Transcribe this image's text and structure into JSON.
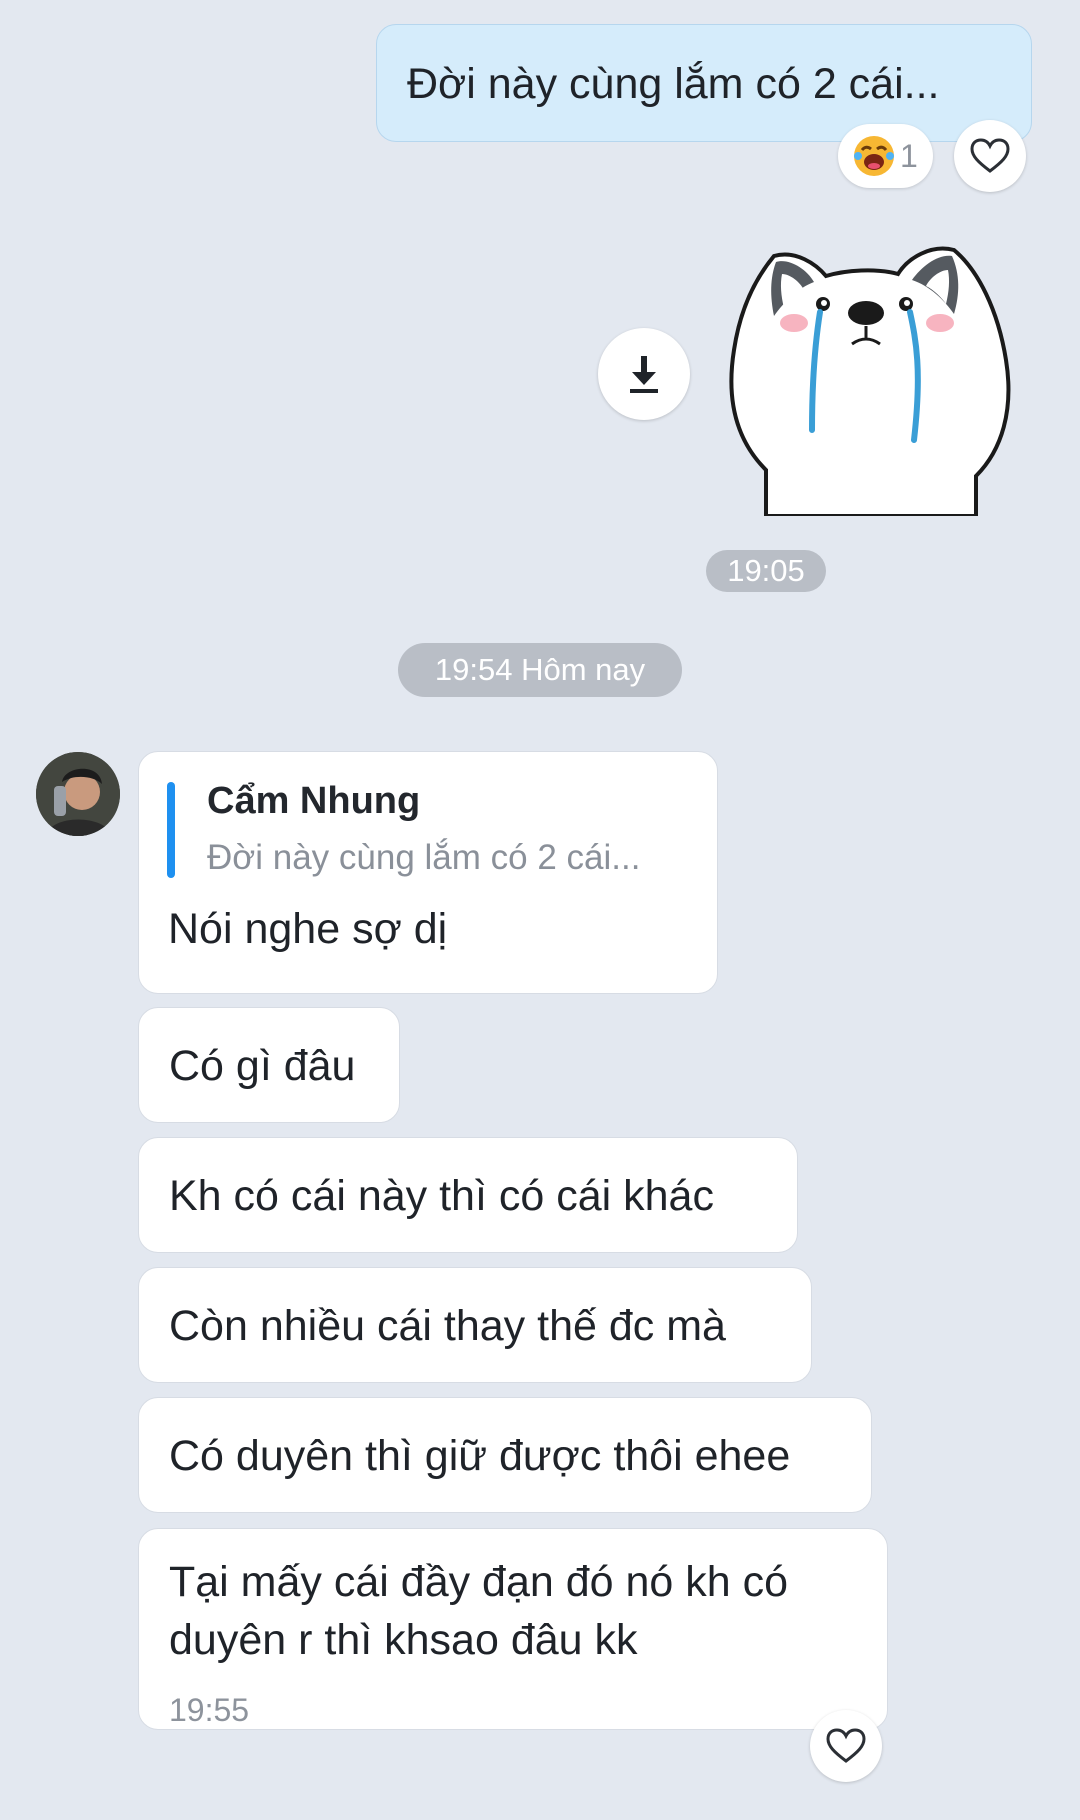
{
  "outgoing": {
    "message": "Đời này cùng lắm có 2 cái...",
    "reaction_count": "1",
    "sticker_time": "19:05"
  },
  "date_separator": "19:54 Hôm nay",
  "incoming": {
    "reply": {
      "quoted_sender": "Cẩm Nhung",
      "quoted_text": "Đời này cùng lắm có 2 cái...",
      "text": "Nói nghe sợ dị"
    },
    "messages": [
      "Có gì đâu",
      "Kh có cái này thì có cái khác",
      "Còn nhiều cái thay thế đc mà",
      "Có duyên thì giữ được thôi ehee",
      "Tại mấy cái đầy đạn đó nó kh có duyên r thì khsao đâu  kk"
    ],
    "last_time": "19:55"
  },
  "colors": {
    "background": "#e3e8f0",
    "outgoing_bubble": "#d5ecfb",
    "incoming_bubble": "#ffffff",
    "quote_accent": "#1e90f0",
    "timestamp_pill": "#b9bec6"
  }
}
